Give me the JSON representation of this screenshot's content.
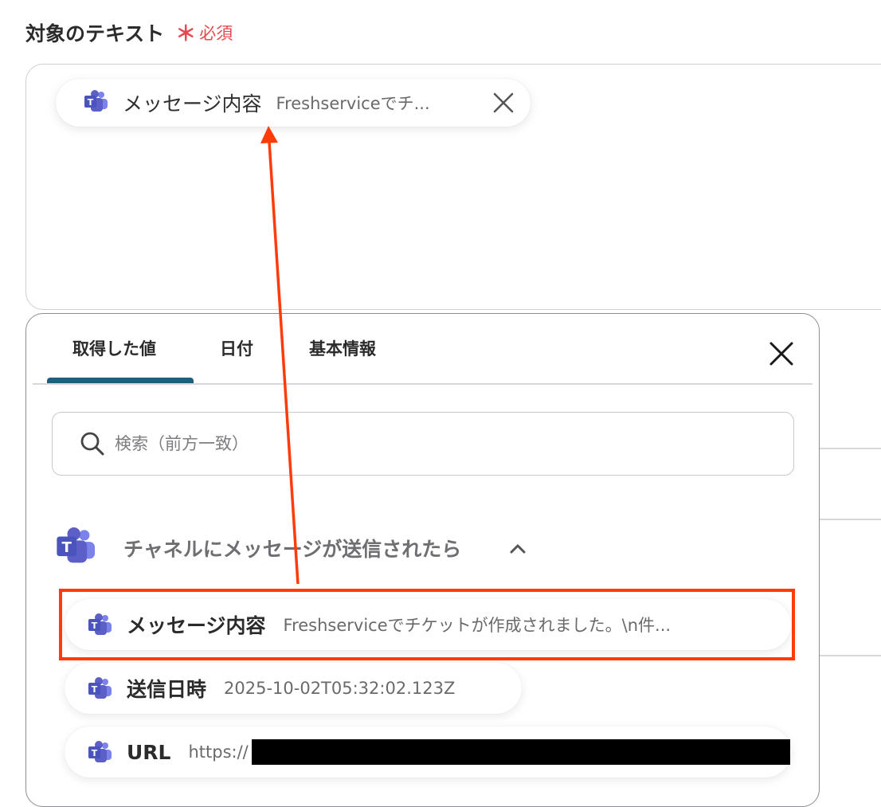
{
  "field": {
    "label": "対象のテキスト",
    "required_mark": "＊",
    "required_text": "必須"
  },
  "chip": {
    "name": "メッセージ内容",
    "value": "Freshserviceでチ..."
  },
  "panel": {
    "tabs": [
      {
        "label": "取得した値",
        "active": true
      },
      {
        "label": "日付",
        "active": false
      },
      {
        "label": "基本情報",
        "active": false
      }
    ],
    "search_placeholder": "検索（前方一致）",
    "section_title": "チャネルにメッセージが送信されたら",
    "items": [
      {
        "name": "メッセージ内容",
        "value": "Freshserviceでチケットが作成されました。\\n件..."
      },
      {
        "name": "送信日時",
        "value": "2025-10-02T05:32:02.123Z"
      },
      {
        "name": "URL",
        "value": "https://"
      }
    ]
  },
  "icons": {
    "teams": "microsoft-teams-icon",
    "close": "close-icon",
    "search": "search-icon",
    "chevron": "chevron-up-icon"
  },
  "colors": {
    "required": "#e5484d",
    "tab_active": "#1e5f7f",
    "teams_purple": "#5b5fc7",
    "highlight": "#ff3b0a"
  }
}
